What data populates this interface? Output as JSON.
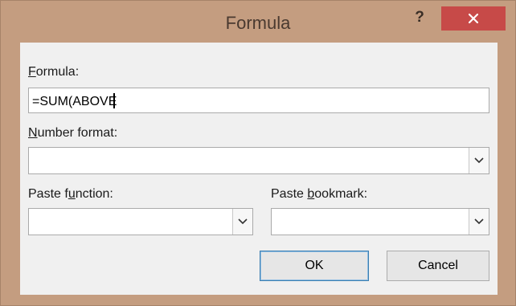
{
  "window": {
    "title": "Formula",
    "help_label": "?",
    "colors": {
      "frame": "#c49d80",
      "close_button": "#c74a48",
      "client": "#f0f0f0"
    }
  },
  "formula": {
    "label_accel": "F",
    "label_rest": "ormula:",
    "value": "=SUM(ABOVE"
  },
  "number_format": {
    "label_accel": "N",
    "label_rest": "umber format:",
    "value": ""
  },
  "paste_function": {
    "label_before": "Paste f",
    "label_accel": "u",
    "label_after": "nction:",
    "value": ""
  },
  "paste_bookmark": {
    "label_before": "Paste ",
    "label_accel": "b",
    "label_after": "ookmark:",
    "value": ""
  },
  "buttons": {
    "ok_label": "OK",
    "cancel_label": "Cancel"
  },
  "icons": {
    "help": "help-icon",
    "close": "close-icon",
    "dropdown": "chevron-down-icon"
  }
}
